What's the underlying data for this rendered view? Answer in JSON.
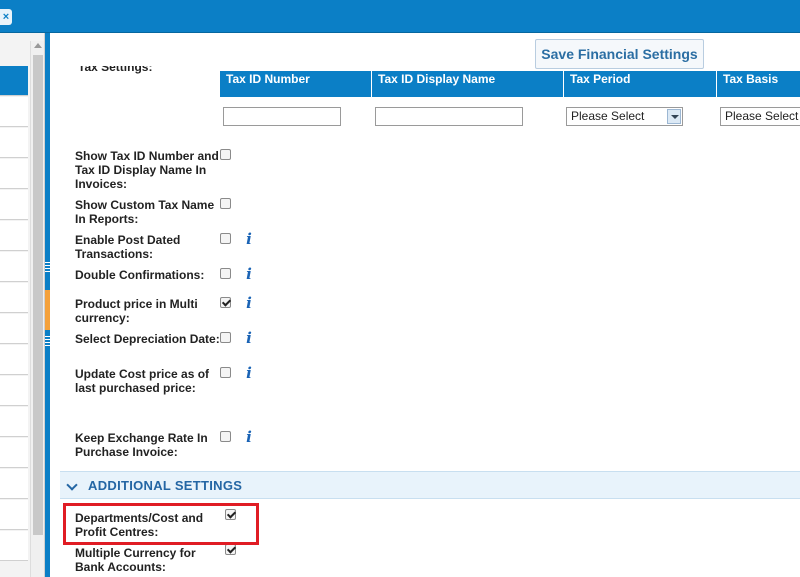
{
  "topbar": {
    "tab_icon": "close-icon",
    "tab_glyph": "×"
  },
  "sidebar": {
    "items": 16,
    "active_index": 0
  },
  "toolbar": {
    "save_label": "Save Financial Settings"
  },
  "tax": {
    "label": "Tax Settings:",
    "columns": [
      "Tax ID Number",
      "Tax ID Display Name",
      "Tax Period",
      "Tax Basis"
    ],
    "tax_id_number": "",
    "tax_id_display_name": "",
    "tax_period": "Please Select",
    "tax_basis": "Please Select"
  },
  "settings": [
    {
      "label": "Show Tax ID Number and Tax ID Display Name In Invoices:",
      "checked": false,
      "info": false
    },
    {
      "label": "Show Custom Tax Name In Reports:",
      "checked": false,
      "info": false
    },
    {
      "label": "Enable Post Dated Transactions:",
      "checked": false,
      "info": true
    },
    {
      "label": "Double Confirmations:",
      "checked": false,
      "info": true
    },
    {
      "label": "Product price in Multi currency:",
      "checked": true,
      "info": true
    },
    {
      "label": "Select Depreciation Date:",
      "checked": false,
      "info": true
    },
    {
      "label": "Update Cost price as of last purchased price:",
      "checked": false,
      "info": true
    },
    {
      "label": "Keep Exchange Rate In Purchase Invoice:",
      "checked": false,
      "info": true
    }
  ],
  "additional": {
    "title": "ADDITIONAL SETTINGS",
    "items": [
      {
        "label": "Departments/Cost and Profit Centres:",
        "checked": true
      },
      {
        "label": "Multiple Currency for Bank Accounts:",
        "checked": true
      }
    ]
  },
  "colors": {
    "accent": "#0b7fc6",
    "section_bg": "#e8f3fb",
    "highlight": "#e01c24",
    "info_icon": "#1a63b5"
  }
}
